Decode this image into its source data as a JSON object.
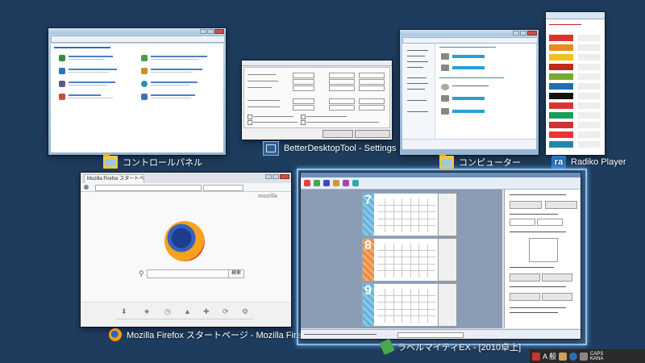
{
  "windows": {
    "control_panel": {
      "caption": "コントロールパネル"
    },
    "better_desktop_tool": {
      "caption": "BetterDesktopTool - Settings"
    },
    "computer": {
      "caption": "コンピューター"
    },
    "radiko": {
      "caption": "Radiko Player"
    },
    "firefox": {
      "caption": "Mozilla Firefox スタートページ - Mozilla Firefox",
      "tab_label": "Mozilla Firefox スタートペ…",
      "brand_text": "mozilla",
      "search_button": "検索"
    },
    "label_maker": {
      "caption": "ラベルマイティEX - [2010卓上]",
      "month_numbers": [
        "7",
        "8",
        "9"
      ]
    }
  },
  "taskbar": {
    "ime_mode": "A 般",
    "tray_text": "CAPS\nKANA"
  },
  "colors": {
    "desktop_bg": "#1e3c5e",
    "selection_border": "#8ec7ff"
  }
}
